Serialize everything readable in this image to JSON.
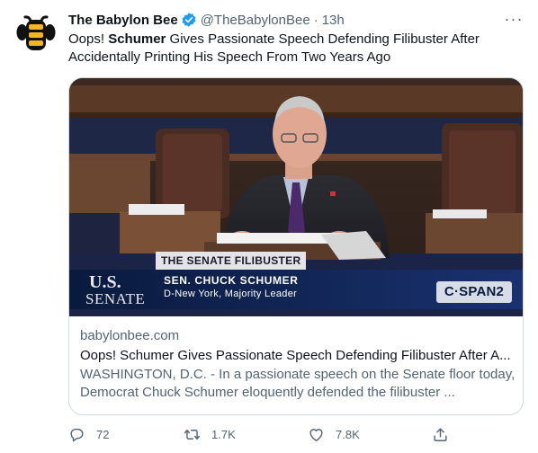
{
  "tweet": {
    "author_name": "The Babylon Bee",
    "handle": "@TheBabylonBee",
    "separator": "·",
    "time": "13h",
    "more_label": "···",
    "text_prefix": "Oops! ",
    "text_bold": "Schumer",
    "text_rest": " Gives Passionate Speech Defending Filibuster After Accidentally Printing His Speech From Two Years Ago"
  },
  "card": {
    "chyron_title": "THE SENATE FILIBUSTER",
    "chyron_name": "SEN. CHUCK SCHUMER",
    "chyron_role": "D-New York, Majority Leader",
    "seal_us": "U.S.",
    "seal_senate": "SENATE",
    "network": "C·SPAN2",
    "domain": "babylonbee.com",
    "title": "Oops! Schumer Gives Passionate Speech Defending Filibuster After A...",
    "description": "WASHINGTON, D.C. - In a passionate speech on the Senate floor today, Democrat Chuck Schumer eloquently defended the filibuster ..."
  },
  "actions": {
    "reply_count": "72",
    "retweet_count": "1.7K",
    "like_count": "7.8K"
  },
  "icons": {
    "avatar": "babylon-bee-logo",
    "verified": "verified-badge-icon",
    "reply": "reply-icon",
    "retweet": "retweet-icon",
    "like": "heart-icon",
    "share": "share-icon"
  },
  "colors": {
    "verified": "#1d9bf0",
    "muted_text": "#536471",
    "primary_text": "#0f1419",
    "border": "#cfd9de"
  }
}
